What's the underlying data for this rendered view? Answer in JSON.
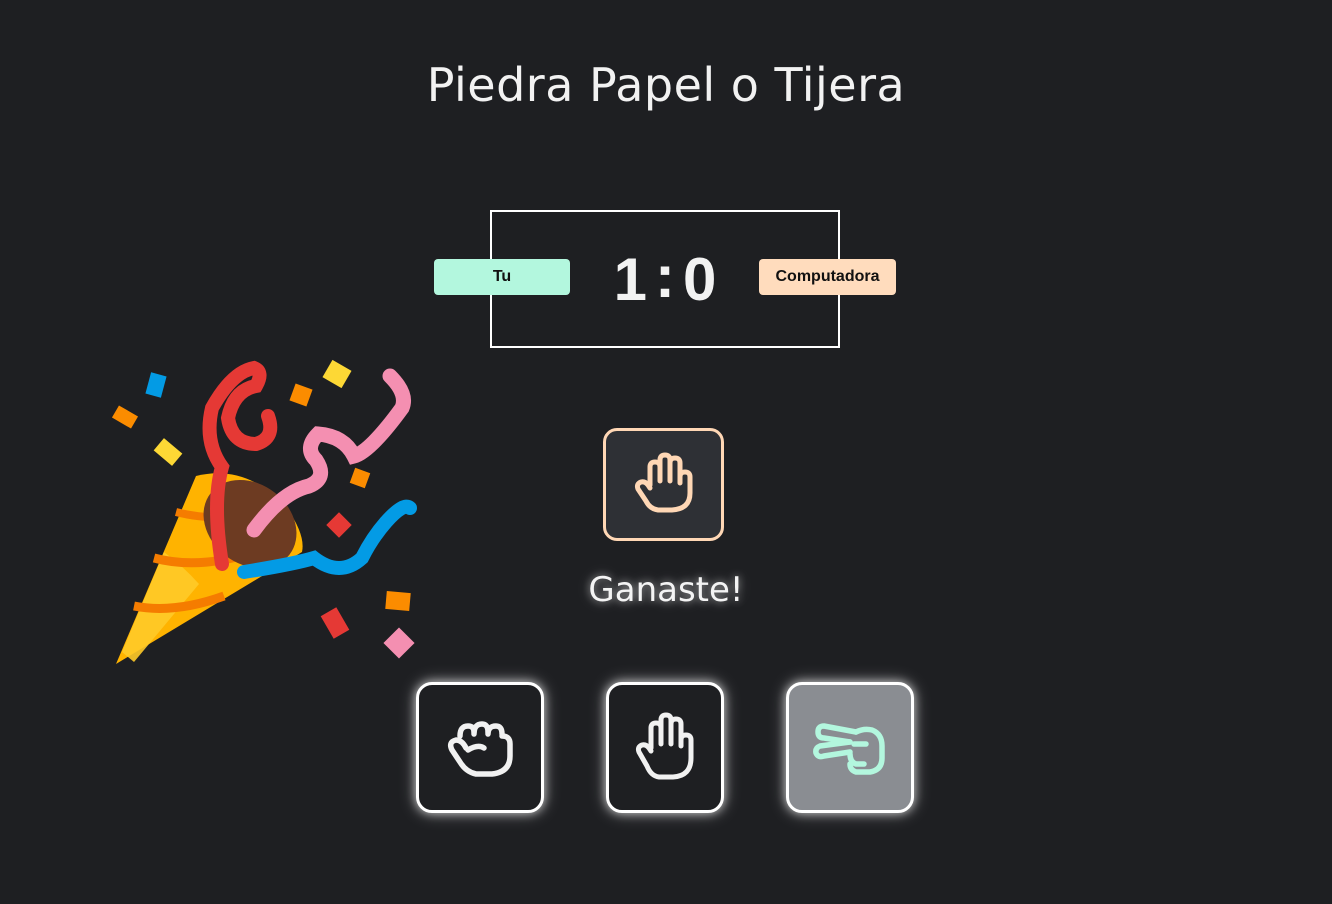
{
  "title": "Piedra Papel o Tijera",
  "scoreboard": {
    "user_label": "Tu",
    "cpu_label": "Computadora",
    "user_score": "1",
    "separator": ":",
    "cpu_score": "0"
  },
  "cpu_choice": {
    "icon": "paper-hand-icon"
  },
  "result": "Ganaste!",
  "choices": [
    {
      "id": "rock",
      "icon": "rock-fist-icon"
    },
    {
      "id": "paper",
      "icon": "paper-hand-icon"
    },
    {
      "id": "scissors",
      "icon": "scissors-hand-icon",
      "selected": true
    }
  ],
  "colors": {
    "background": "#1e1f22",
    "user_badge": "#b3f7de",
    "cpu_badge": "#ffdcbd",
    "cpu_choice_border": "#ffd7b5",
    "selected_button": "#8a8d92",
    "mint_icon": "#b3f7de",
    "peach_icon": "#ffd7b5"
  }
}
